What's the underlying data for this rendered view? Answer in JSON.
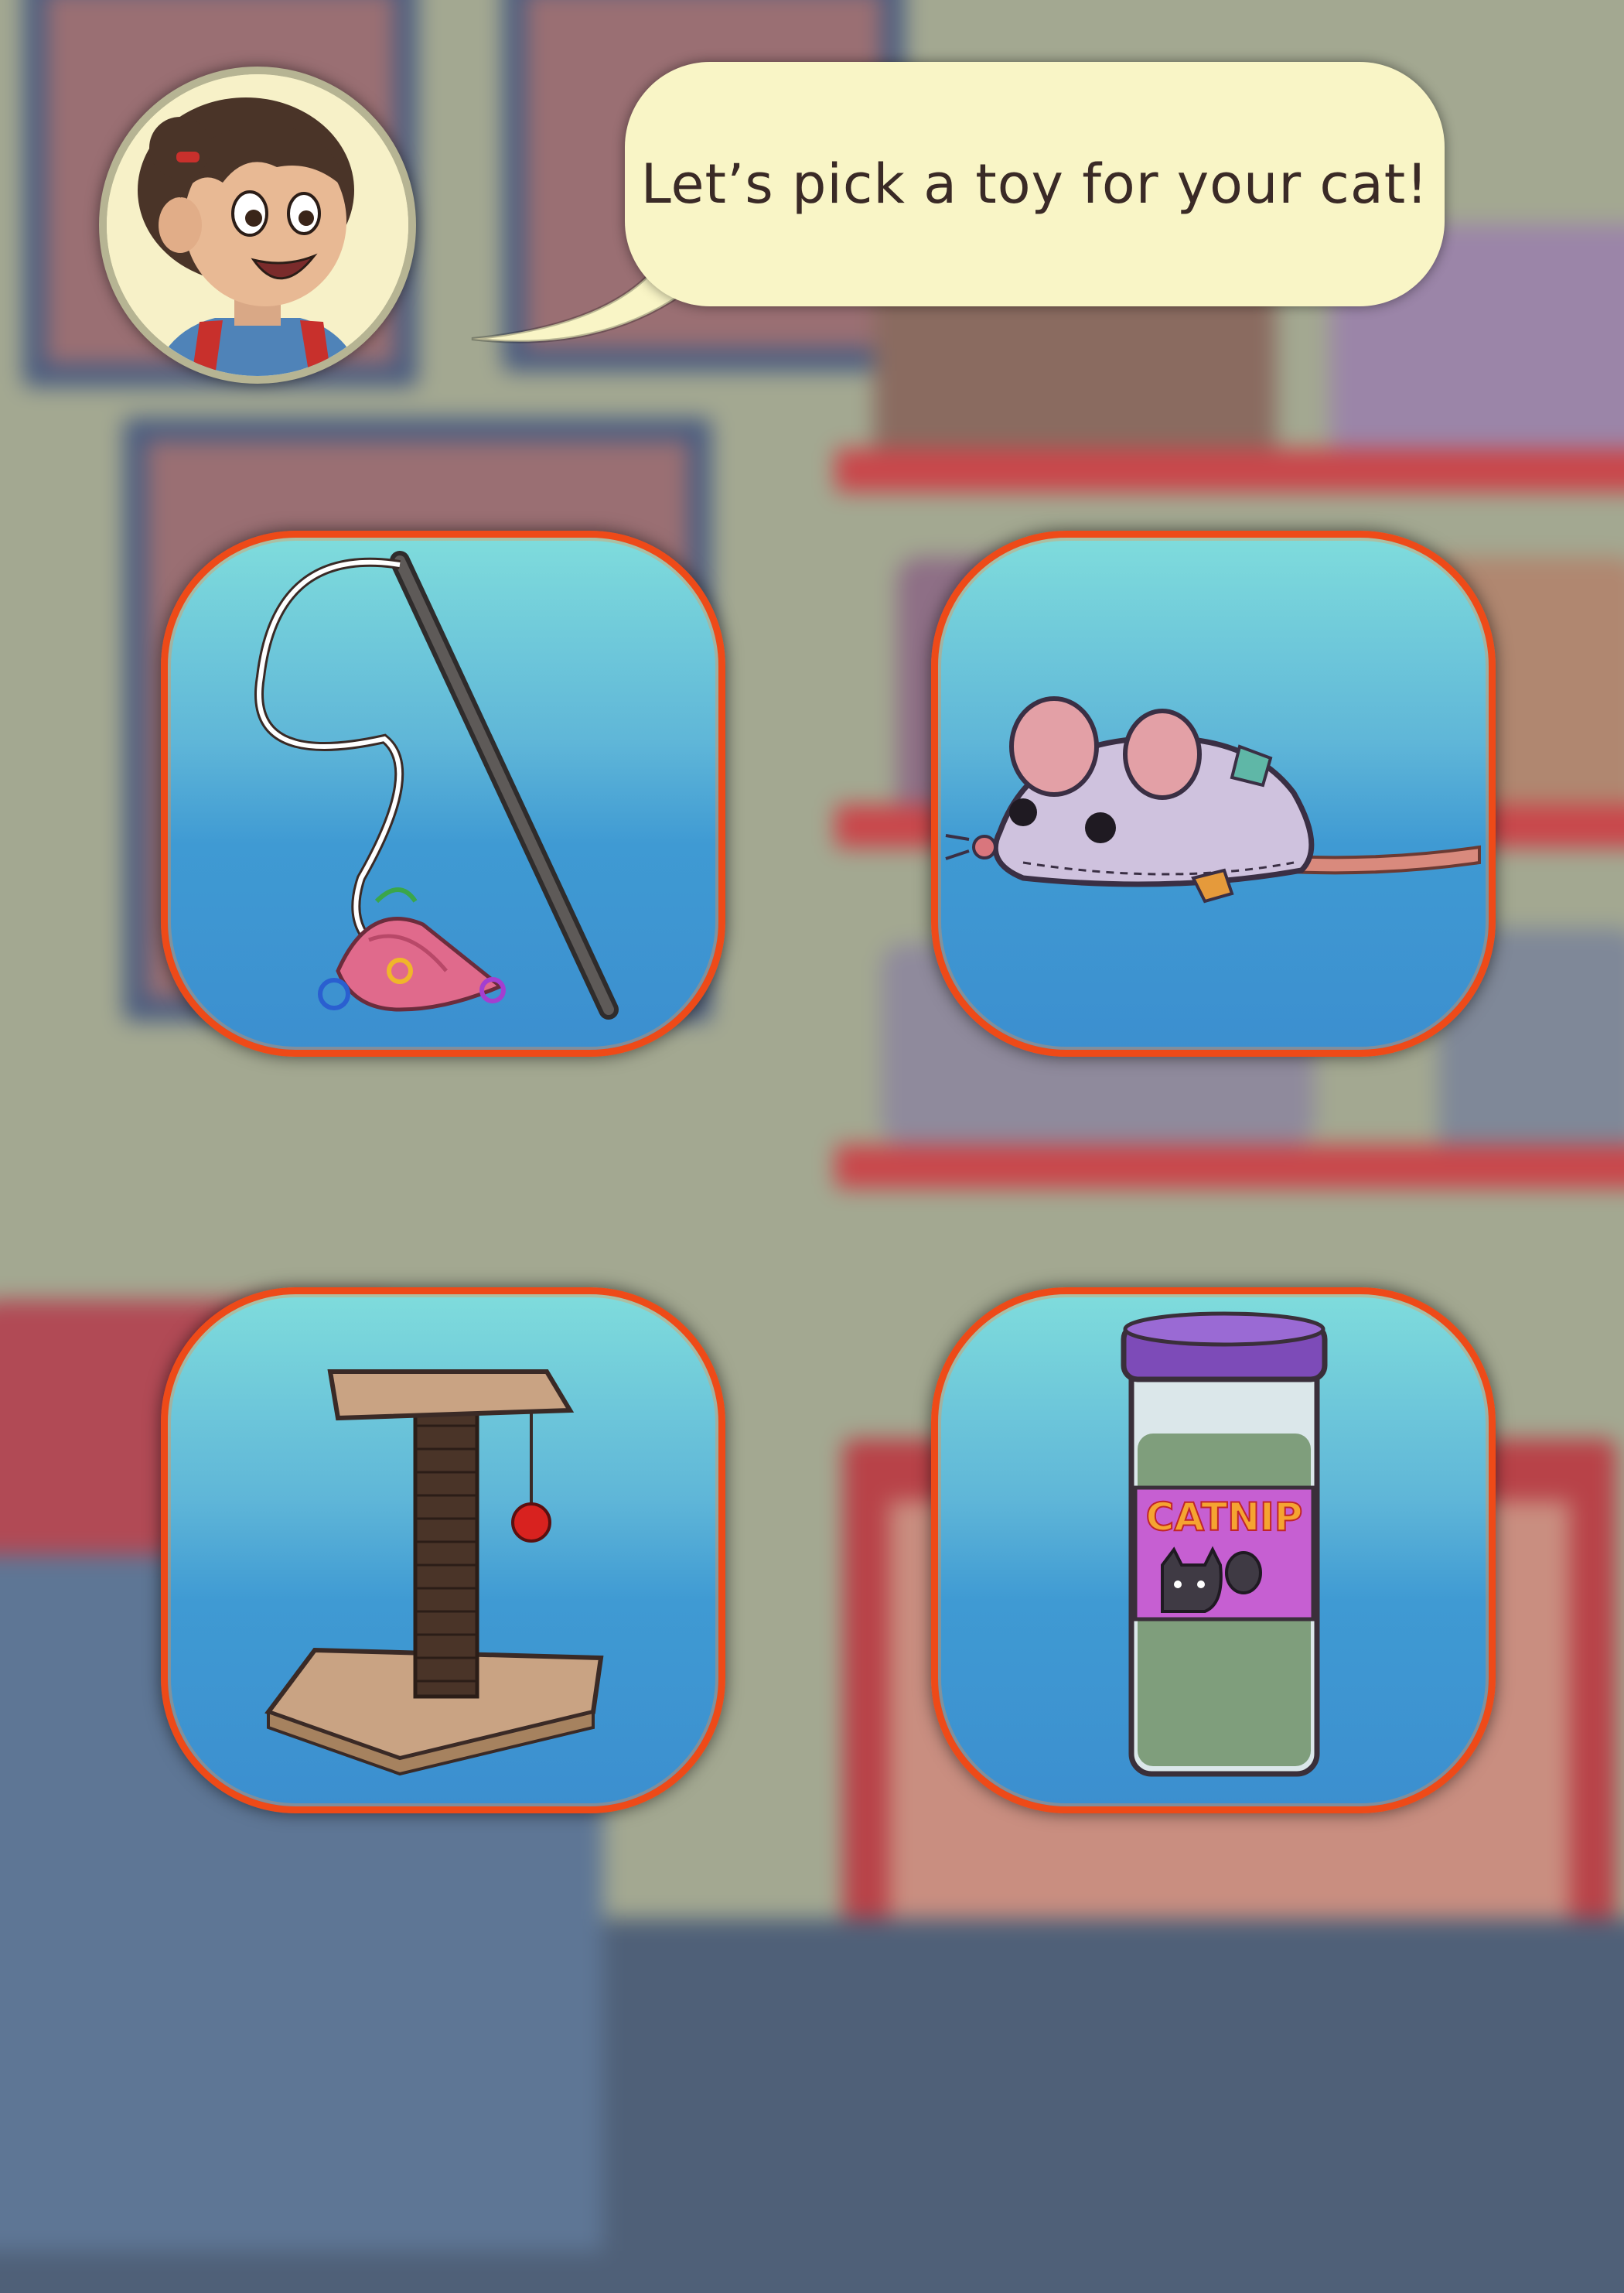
{
  "dialog": {
    "speaker_avatar": "girl-guide-portrait",
    "text": "Let’s pick a toy for your cat!"
  },
  "toys": [
    {
      "id": "feather-wand",
      "icon": "feather-wand-toy"
    },
    {
      "id": "toy-mouse",
      "icon": "stuffed-mouse-toy"
    },
    {
      "id": "scratching-post",
      "icon": "scratching-post-toy"
    },
    {
      "id": "catnip",
      "icon": "catnip-jar",
      "label": "CATNIP"
    }
  ],
  "colors": {
    "card_border": "#ee4a18",
    "card_top": "#7fdcdc",
    "card_bottom": "#3c8fcf",
    "bubble": "#f9f5c6"
  }
}
